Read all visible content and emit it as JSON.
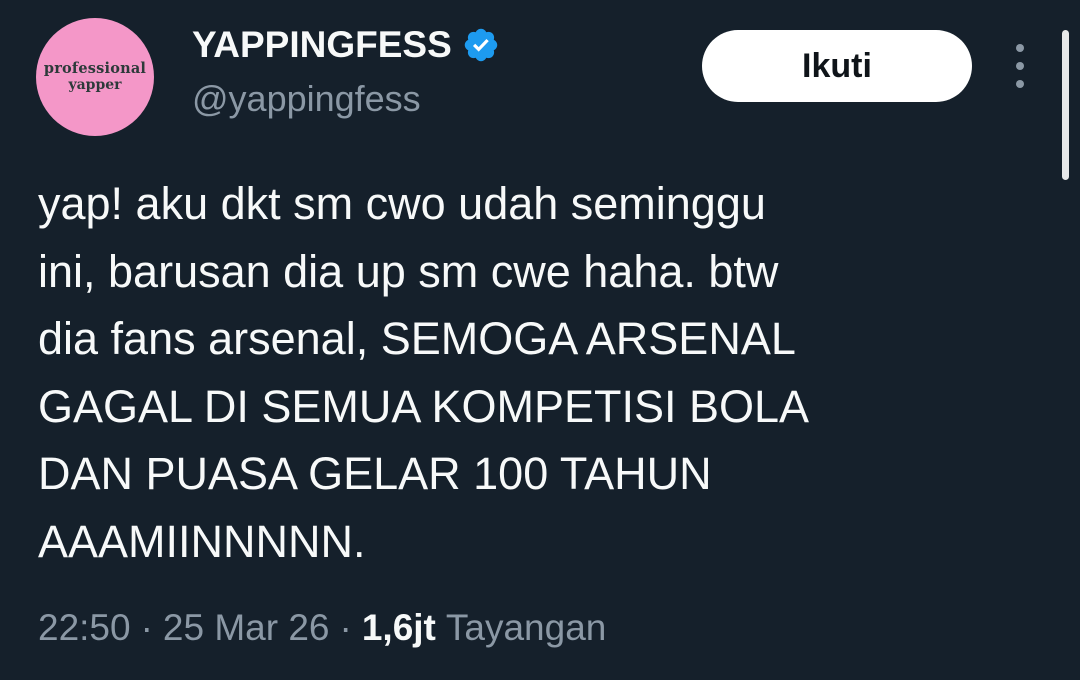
{
  "author": {
    "avatar_text_line1": "professional",
    "avatar_text_line2": "yapper",
    "display_name": "YAPPINGFESS",
    "handle": "@yappingfess",
    "verified": true,
    "verified_icon": "verified-badge-icon",
    "verified_color": "#1d9bf0"
  },
  "actions": {
    "follow_label": "Ikuti",
    "more_icon": "more-vertical-icon"
  },
  "tweet": {
    "text_lines": [
      "yap! aku dkt sm cwo udah seminggu",
      "ini, barusan dia up sm cwe haha. btw",
      "dia fans arsenal, SEMOGA ARSENAL",
      "GAGAL DI SEMUA KOMPETISI BOLA",
      "DAN PUASA GELAR 100 TAHUN",
      "AAAMIINNNNN."
    ]
  },
  "meta": {
    "time": "22:50",
    "separator": "·",
    "date": "25 Mar 26",
    "views_count": "1,6jt",
    "views_label": "Tayangan"
  },
  "colors": {
    "background": "#15202b",
    "primary_text": "#f7f9f9",
    "secondary_text": "#8b98a5",
    "avatar_bg": "#f497c8",
    "button_bg": "#ffffff"
  }
}
